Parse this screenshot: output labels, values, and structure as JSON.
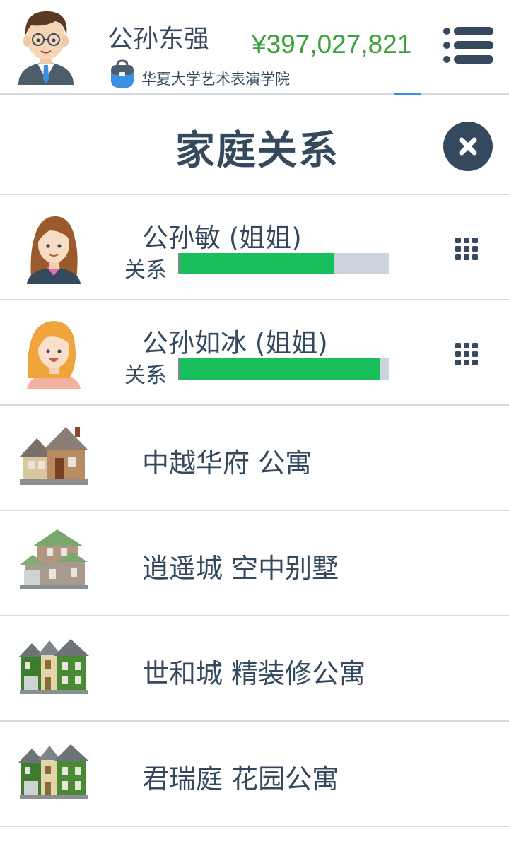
{
  "player": {
    "name": "公孙东强",
    "school": "华夏大学艺术表演学院",
    "money": "¥397,027,821"
  },
  "page": {
    "title": "家庭关系"
  },
  "colors": {
    "text": "#34495e",
    "money": "#3aa23a",
    "bar_fill": "#18bf5a",
    "bar_track": "#cbd3dc",
    "divider": "#d7dade"
  },
  "family": [
    {
      "name": "公孙敏 (姐姐)",
      "relation_label": "关系",
      "relation_level": 0.74,
      "avatar": "brunette-woman-avatar"
    },
    {
      "name": "公孙如冰 (姐姐)",
      "relation_label": "关系",
      "relation_level": 0.96,
      "avatar": "blonde-woman-avatar"
    }
  ],
  "properties": [
    {
      "name": "中越华府 公寓",
      "icon": "brown-house-icon"
    },
    {
      "name": "逍遥城 空中别墅",
      "icon": "villa-icon"
    },
    {
      "name": "世和城 精装修公寓",
      "icon": "green-townhouse-icon"
    },
    {
      "name": "君瑞庭 花园公寓",
      "icon": "green-townhouse-icon"
    }
  ]
}
